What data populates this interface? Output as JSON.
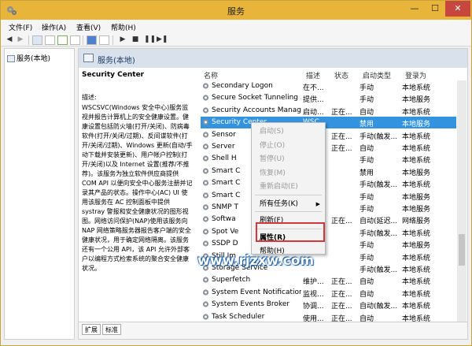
{
  "window": {
    "title": "服务",
    "minimize": "—",
    "maximize": "☐",
    "close": "✕"
  },
  "menubar": {
    "items": [
      "文件(F)",
      "操作(A)",
      "查看(V)",
      "帮助(H)"
    ]
  },
  "toolbar": {
    "icons": [
      "back-icon",
      "forward-icon",
      "show-tree-icon",
      "properties-icon",
      "refresh-icon",
      "export-icon",
      "help-icon",
      "console-icon",
      "start-icon",
      "stop-icon",
      "pause-icon",
      "restart-icon"
    ]
  },
  "tree": {
    "root": "服务(本地)"
  },
  "main": {
    "header": "服务(本地)",
    "detail": {
      "title": "Security Center",
      "desc_label": "描述:",
      "desc_text": "WSCSVC(Windows 安全中心)服务监视并报告计算机上的安全健康设置。健康设置包括防火墙(打开/关闭)、防病毒软件(打开/关闭/过期)、反间谍软件(打开/关闭/过期)、Windows 更新(自动/手动下载并安装更新)、用户帐户控制(打开/关闭)以及 Internet 设置(推荐/不推荐)。该服务为独立软件供应商提供 COM API 以便向安全中心服务注册并记录其产品的状态。操作中心(AC) UI 使用该服务在 AC 控制面板中提供 systray 警报和安全健康状况的图形视图。网络访问保护(NAP)使用该服务向 NAP 网络策略服务器报告客户端的安全健康状况，用于确定网络隔离。该服务还有一个公用 API，该 API 允许外部客户以编程方式检索系统的聚合安全健康状况。"
    },
    "columns": [
      "名称",
      "描述",
      "状态",
      "启动类型",
      "登录为"
    ],
    "rows": [
      {
        "name": "Secondary Logon",
        "desc": "在不...",
        "status": "",
        "startup": "手动",
        "logon": "本地系统"
      },
      {
        "name": "Secure Socket Tunneling ...",
        "desc": "提供...",
        "status": "",
        "startup": "手动",
        "logon": "本地服务"
      },
      {
        "name": "Security Accounts Manag...",
        "desc": "启动...",
        "status": "正在...",
        "startup": "自动",
        "logon": "本地系统"
      },
      {
        "name": "Security Center",
        "desc": "WSC...",
        "status": "",
        "startup": "禁用",
        "logon": "本地服务"
      },
      {
        "name": "Sensor",
        "desc": "",
        "status": "正在...",
        "startup": "手动(触发...",
        "logon": "本地系统"
      },
      {
        "name": "Server",
        "desc": "",
        "status": "正在...",
        "startup": "自动",
        "logon": "本地系统"
      },
      {
        "name": "Shell H",
        "desc": "",
        "status": "",
        "startup": "手动",
        "logon": "本地系统"
      },
      {
        "name": "Smart C",
        "desc": "",
        "status": "",
        "startup": "禁用",
        "logon": "本地服务"
      },
      {
        "name": "Smart C",
        "desc": "",
        "status": "",
        "startup": "手动(触发...",
        "logon": "本地系统"
      },
      {
        "name": "Smart C",
        "desc": "",
        "status": "",
        "startup": "手动",
        "logon": "本地服务"
      },
      {
        "name": "SNMP T",
        "desc": "",
        "status": "",
        "startup": "手动",
        "logon": "本地服务"
      },
      {
        "name": "Softwa",
        "desc": "",
        "status": "正在...",
        "startup": "自动(延迟...",
        "logon": "网络服务"
      },
      {
        "name": "Spot Ve",
        "desc": "",
        "status": "",
        "startup": "手动(触发...",
        "logon": "本地系统"
      },
      {
        "name": "SSDP D",
        "desc": "",
        "status": "",
        "startup": "手动",
        "logon": "本地服务"
      },
      {
        "name": "Still Im",
        "desc": "",
        "status": "",
        "startup": "手动",
        "logon": "本地系统"
      },
      {
        "name": "Storage Service",
        "desc": "",
        "status": "",
        "startup": "手动(触发...",
        "logon": "本地系统"
      },
      {
        "name": "Superfetch",
        "desc": "维护...",
        "status": "正在...",
        "startup": "自动",
        "logon": "本地系统"
      },
      {
        "name": "System Event Notification...",
        "desc": "监视...",
        "status": "正在...",
        "startup": "自动",
        "logon": "本地系统"
      },
      {
        "name": "System Events Broker",
        "desc": "协调...",
        "status": "正在...",
        "startup": "自动(触发...",
        "logon": "本地系统"
      },
      {
        "name": "Task Scheduler",
        "desc": "使用...",
        "status": "正在...",
        "startup": "自动",
        "logon": "本地系统"
      }
    ],
    "selected_row": 3,
    "tabs": [
      "扩展",
      "标准"
    ]
  },
  "context_menu": {
    "items": [
      {
        "label": "启动(S)",
        "disabled": true
      },
      {
        "label": "停止(O)",
        "disabled": true
      },
      {
        "label": "暂停(U)",
        "disabled": true
      },
      {
        "label": "恢复(M)",
        "disabled": true
      },
      {
        "label": "重新启动(E)",
        "disabled": true
      },
      {
        "label": "所有任务(K)",
        "disabled": false,
        "submenu": true
      },
      {
        "label": "刷新(F)",
        "disabled": false
      },
      {
        "label": "属性(R)",
        "disabled": false,
        "bold": true
      },
      {
        "label": "帮助(H)",
        "disabled": false
      }
    ],
    "submenu_arrow": "▶"
  },
  "watermark": "www.rjzxw.com",
  "colors": {
    "titlebar": "#e9b43a",
    "close": "#c7463d",
    "selection": "#3393df",
    "highlight": "#d23a3a"
  }
}
